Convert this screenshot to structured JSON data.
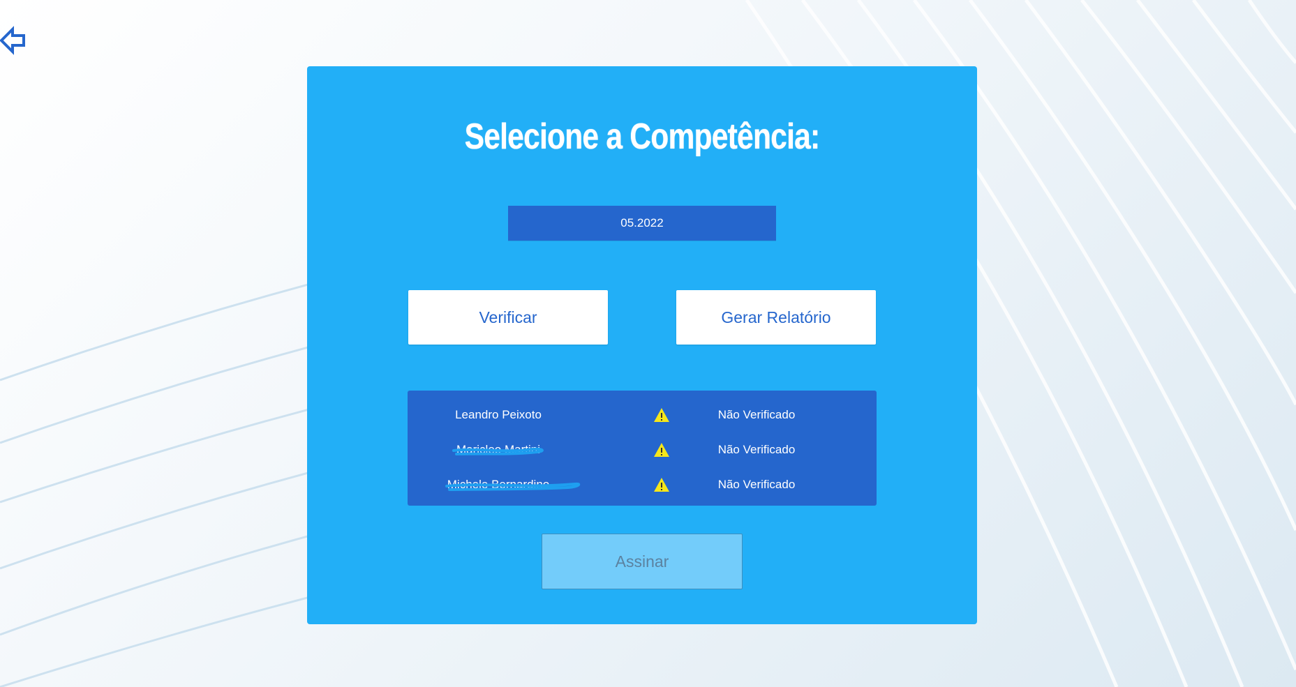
{
  "nav": {
    "back_icon": "arrow-left-icon"
  },
  "panel": {
    "title": "Selecione a Competência:",
    "competencia": "05.2022",
    "verify_label": "Verificar",
    "report_label": "Gerar Relatório",
    "sign_label": "Assinar"
  },
  "employees": [
    {
      "name": "Leandro Peixoto",
      "status": "Não Verificado",
      "icon": "warning-icon"
    },
    {
      "name": "Maricleo Martini",
      "status": "Não Verificado",
      "icon": "warning-icon"
    },
    {
      "name": "Michele Bernardino",
      "status": "Não Verificado",
      "icon": "warning-icon"
    }
  ],
  "colors": {
    "panel_bg": "#22aff7",
    "accent": "#2566cd",
    "button_bg": "#ffffff",
    "sign_disabled": "#73ccfa",
    "warning": "#f5e61a"
  }
}
